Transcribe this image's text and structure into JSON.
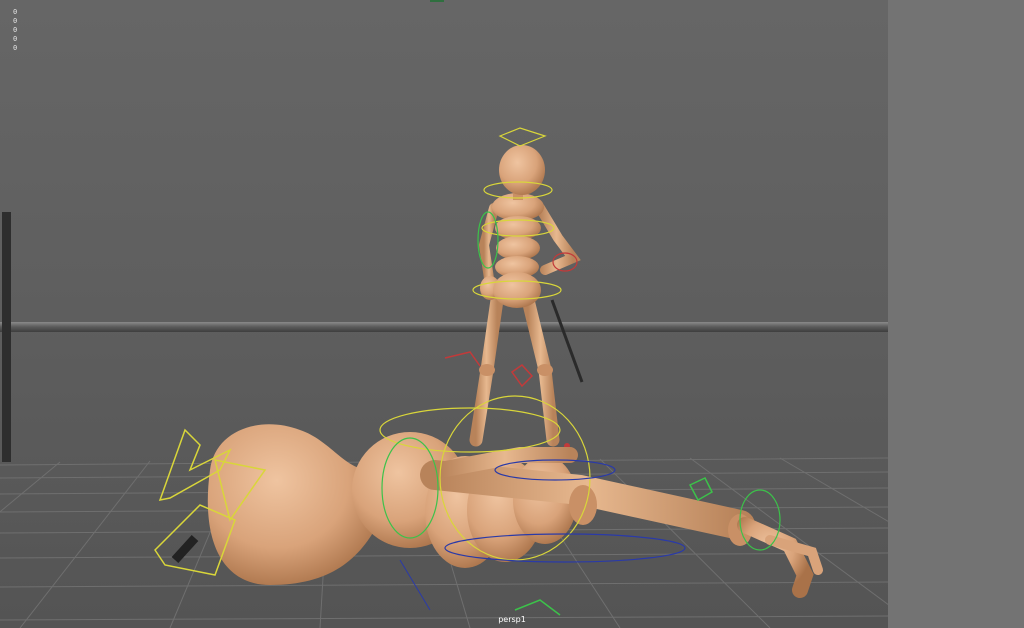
{
  "hud": {
    "stats": [
      "0",
      "0",
      "0",
      "0",
      "0"
    ]
  },
  "viewport": {
    "camera": "persp1"
  },
  "colors": {
    "skin": "#d9a37a",
    "skin_dark": "#b98459",
    "control_yellow": "#d9d63a",
    "control_green": "#3cc24a",
    "control_red": "#c23a3a",
    "control_blue": "#2a3aa8",
    "grid": "#6e6e6e"
  }
}
